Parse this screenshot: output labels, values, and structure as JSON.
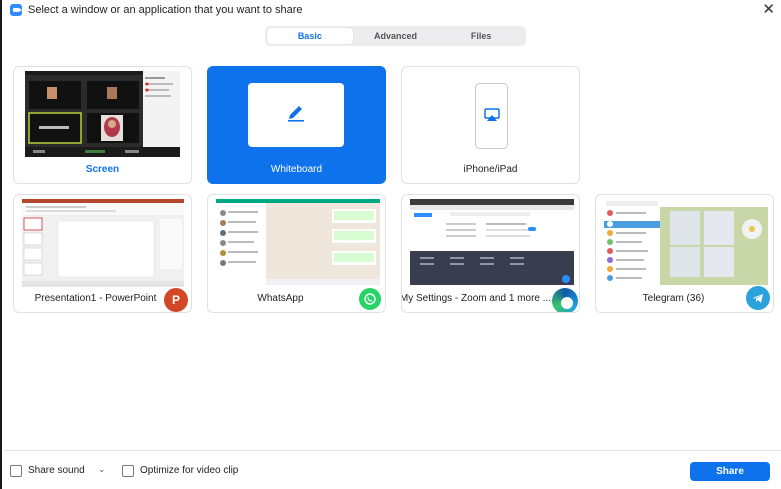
{
  "window": {
    "title": "Select a window or an application that you want to share"
  },
  "tabs": [
    {
      "label": "Basic",
      "active": true
    },
    {
      "label": "Advanced",
      "active": false
    },
    {
      "label": "Files",
      "active": false
    }
  ],
  "cards": [
    {
      "label": "Screen",
      "icon": "screen-thumbnail"
    },
    {
      "label": "Whiteboard",
      "icon": "pencil-icon",
      "selected": true
    },
    {
      "label": "iPhone/iPad",
      "icon": "airplay-phone-icon"
    },
    {
      "label": "Presentation1 - PowerPoint",
      "icon": "powerpoint-icon"
    },
    {
      "label": "WhatsApp",
      "icon": "whatsapp-icon"
    },
    {
      "label": "My Settings - Zoom and 1 more ...",
      "icon": "edge-icon"
    },
    {
      "label": "Telegram (36)",
      "icon": "telegram-icon"
    }
  ],
  "bottom": {
    "share_sound": "Share sound",
    "optimize": "Optimize for video clip",
    "share_button": "Share"
  },
  "colors": {
    "accent": "#0e72ed",
    "whatsapp": "#25d366",
    "powerpoint": "#d24726",
    "telegram": "#2aa3dd"
  }
}
